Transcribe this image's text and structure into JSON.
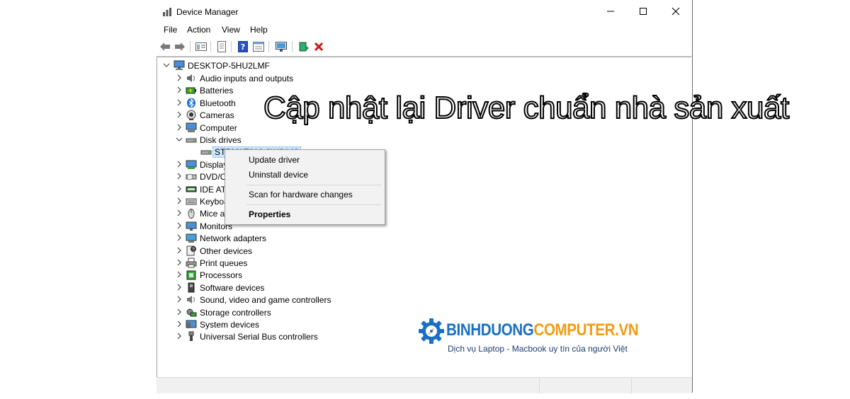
{
  "window": {
    "title": "Device Manager"
  },
  "menu": [
    "File",
    "Action",
    "View",
    "Help"
  ],
  "tree": {
    "root": "DESKTOP-5HU2LMF",
    "items": [
      {
        "label": "Audio inputs and outputs",
        "icon": "speaker-icon"
      },
      {
        "label": "Batteries",
        "icon": "battery-icon"
      },
      {
        "label": "Bluetooth",
        "icon": "bluetooth-icon"
      },
      {
        "label": "Cameras",
        "icon": "camera-icon"
      },
      {
        "label": "Computer",
        "icon": "computer-icon"
      },
      {
        "label": "Disk drives",
        "icon": "disk-drive-icon",
        "expanded": true
      },
      {
        "label": "ST500LT012-9WS142",
        "icon": "hard-disk-icon",
        "child": true,
        "selected": true
      },
      {
        "label": "Display adapters",
        "icon": "display-adapter-icon"
      },
      {
        "label": "DVD/CD-ROM drives",
        "icon": "dvd-drive-icon"
      },
      {
        "label": "IDE ATA/ATAPI controllers",
        "icon": "ide-controller-icon"
      },
      {
        "label": "Keyboards",
        "icon": "keyboard-icon"
      },
      {
        "label": "Mice and other pointing devices",
        "icon": "mouse-icon"
      },
      {
        "label": "Monitors",
        "icon": "monitor-icon"
      },
      {
        "label": "Network adapters",
        "icon": "network-adapter-icon"
      },
      {
        "label": "Other devices",
        "icon": "unknown-device-icon"
      },
      {
        "label": "Print queues",
        "icon": "printer-icon"
      },
      {
        "label": "Processors",
        "icon": "processor-icon"
      },
      {
        "label": "Software devices",
        "icon": "software-device-icon"
      },
      {
        "label": "Sound, video and game controllers",
        "icon": "sound-controller-icon"
      },
      {
        "label": "Storage controllers",
        "icon": "storage-controller-icon"
      },
      {
        "label": "System devices",
        "icon": "system-device-icon"
      },
      {
        "label": "Universal Serial Bus controllers",
        "icon": "usb-icon"
      }
    ]
  },
  "context_menu": {
    "update": "Update driver",
    "uninstall": "Uninstall device",
    "scan": "Scan for hardware changes",
    "properties": "Properties"
  },
  "overlay_text": "Cập nhật lại Driver chuẩn nhà sản xuất",
  "brand": {
    "name_part1": "BINHDUONG",
    "name_part2": "COMPUTER.VN",
    "tagline": "Dịch vụ Laptop - Macbook uy tín của người Việt",
    "color1": "#1a6fc4",
    "color2": "#f39c12"
  }
}
